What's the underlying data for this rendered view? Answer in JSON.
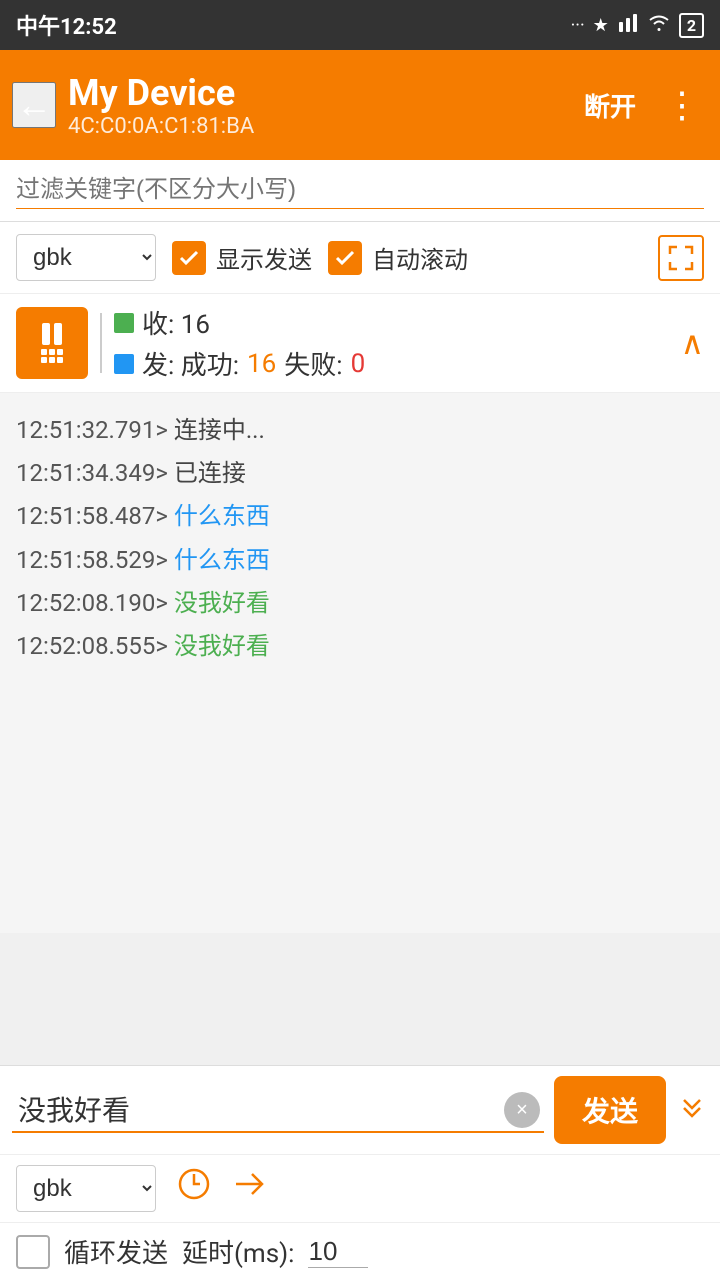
{
  "status_bar": {
    "time": "中午12:52",
    "icons": [
      "...",
      "bluetooth",
      "signal",
      "wifi",
      "battery-2"
    ]
  },
  "toolbar": {
    "back_icon": "←",
    "device_name": "My Device",
    "device_mac": "4C:C0:0A:C1:81:BA",
    "disconnect_label": "断开",
    "more_icon": "⋮"
  },
  "filter": {
    "placeholder": "过滤关键字(不区分大小写)"
  },
  "controls": {
    "encoding": "gbk",
    "show_send_label": "显示发送",
    "auto_scroll_label": "自动滚动",
    "fullscreen_icon": "⤢"
  },
  "stats": {
    "recv_label": "收: 16",
    "send_label": "发: 成功: ",
    "send_success": "16",
    "send_fail_label": "失败: ",
    "send_fail": "0",
    "collapse_icon": "∧"
  },
  "log": {
    "entries": [
      {
        "ts": "12:51:32.791>",
        "msg": " 连接中...",
        "color": "default"
      },
      {
        "ts": "12:51:34.349>",
        "msg": " 已连接",
        "color": "default"
      },
      {
        "ts": "12:51:58.487>",
        "msg": " 什么东西",
        "color": "blue"
      },
      {
        "ts": "12:51:58.529>",
        "msg": " 什么东西",
        "color": "blue"
      },
      {
        "ts": "12:52:08.190>",
        "msg": " 没我好看",
        "color": "green"
      },
      {
        "ts": "12:52:08.555>",
        "msg": " 没我好看",
        "color": "green"
      }
    ]
  },
  "send_area": {
    "input_value": "没我好看",
    "send_button_label": "发送",
    "expand_icon": "≫",
    "clear_icon": "×"
  },
  "bottom_options": {
    "encoding": "gbk",
    "history_icon": "🕐",
    "send_direct_icon": "➤"
  },
  "loop": {
    "label": "循环发送",
    "delay_label": "延时(ms):",
    "delay_value": "10"
  }
}
